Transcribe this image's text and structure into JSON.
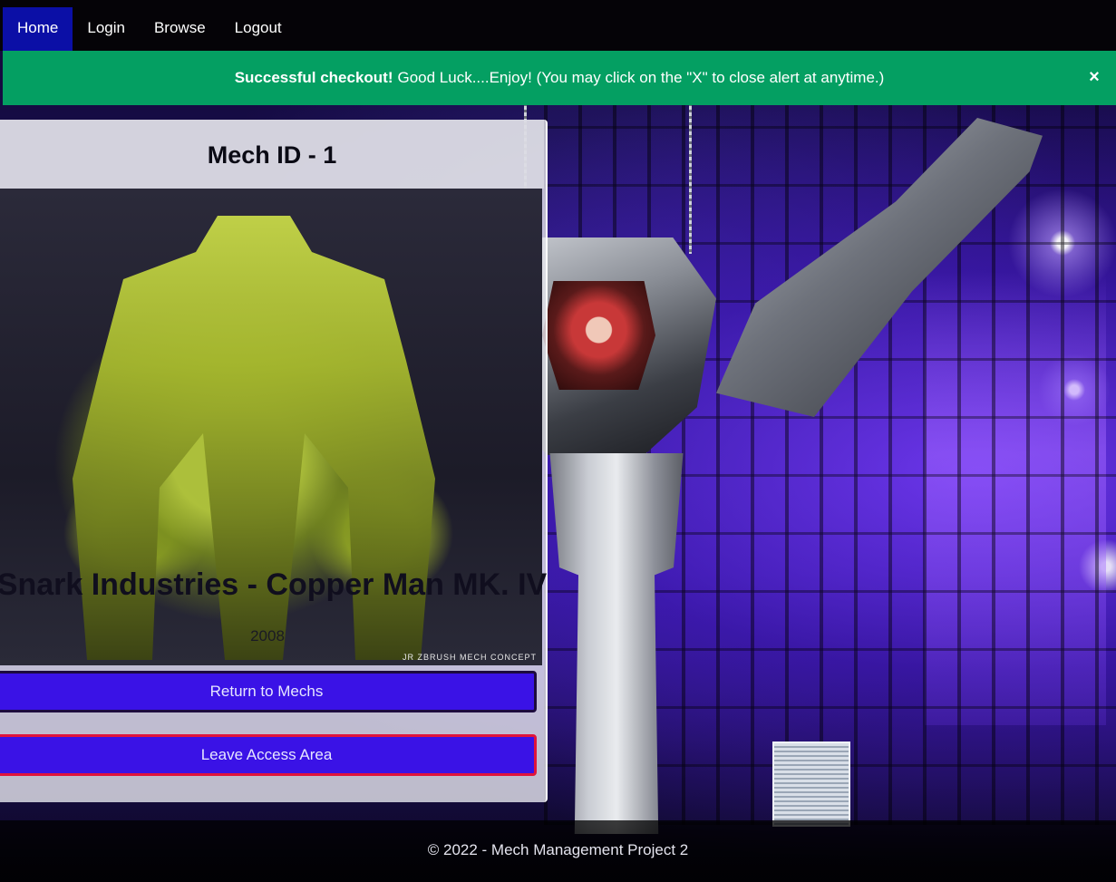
{
  "nav": {
    "items": [
      {
        "label": "Home",
        "active": true
      },
      {
        "label": "Login",
        "active": false
      },
      {
        "label": "Browse",
        "active": false
      },
      {
        "label": "Logout",
        "active": false
      }
    ]
  },
  "alert": {
    "strong": "Successful checkout!",
    "message": "Good Luck....Enjoy! (You may click on the \"X\" to close alert at anytime.)",
    "close_label": "×",
    "color": "#049f62"
  },
  "card": {
    "header": "Mech ID - 1",
    "image_caption": "JR ZBRUSH MECH CONCEPT",
    "title": "Snark Industries - Copper Man MK. IV",
    "year": "2008",
    "return_button": "Return to Mechs",
    "leave_button": "Leave Access Area"
  },
  "footer": {
    "text": "© 2022 - Mech Management Project 2"
  },
  "colors": {
    "nav_active": "#0b0fa6",
    "button": "#3a12e6",
    "leave_border": "#e0143c"
  }
}
